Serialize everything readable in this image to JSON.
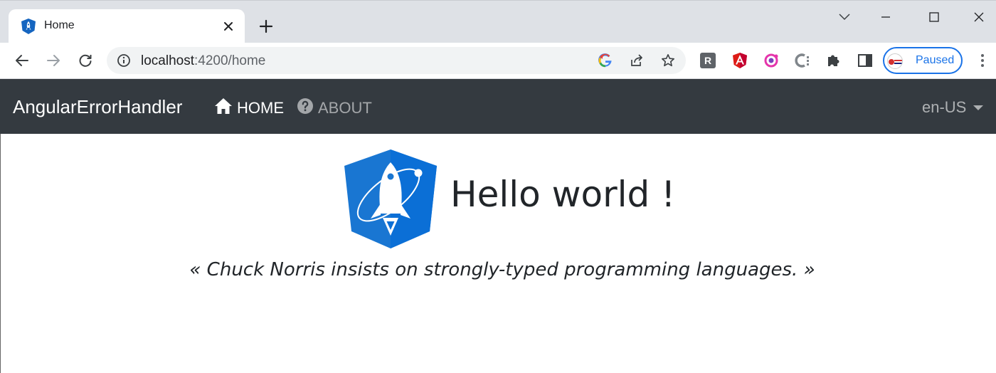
{
  "browser": {
    "tab": {
      "title": "Home",
      "favicon": "angular-rocket-icon"
    },
    "controls": {
      "new_tab": "plus-icon",
      "tab_search": "chevron-down-icon",
      "minimize": "minimize-icon",
      "maximize": "maximize-icon",
      "close": "close-icon"
    },
    "toolbar": {
      "back": "back-arrow-icon",
      "forward": "forward-arrow-icon",
      "reload": "reload-icon",
      "url_host": "localhost",
      "url_rest": ":4200/home",
      "omnibox_actions": [
        "google-lens-icon",
        "share-icon",
        "bookmark-star-icon"
      ],
      "extensions": [
        {
          "name": "r-extension-icon",
          "label": "R"
        },
        {
          "name": "angular-extension-icon",
          "label": ""
        },
        {
          "name": "redux-extension-icon",
          "label": ""
        },
        {
          "name": "c-extension-icon",
          "label": "C"
        },
        {
          "name": "puzzle-extensions-icon",
          "label": ""
        },
        {
          "name": "side-panel-icon",
          "label": ""
        }
      ],
      "profile_label": "Paused"
    }
  },
  "app": {
    "brand": "AngularErrorHandler",
    "nav": [
      {
        "label": "HOME",
        "icon": "home-icon",
        "active": true
      },
      {
        "label": "ABOUT",
        "icon": "question-circle-icon",
        "active": false
      }
    ],
    "language": "en-US",
    "hero": {
      "logo": "angular-rocket-logo",
      "title": "Hello world !"
    },
    "quote": "« Chuck Norris insists on strongly-typed programming languages. »"
  },
  "colors": {
    "navbar_bg": "#343a40",
    "tabstrip_bg": "#dee1e6",
    "brand_blue": "#1a73e8",
    "logo_blue": "#0b6fd6"
  }
}
